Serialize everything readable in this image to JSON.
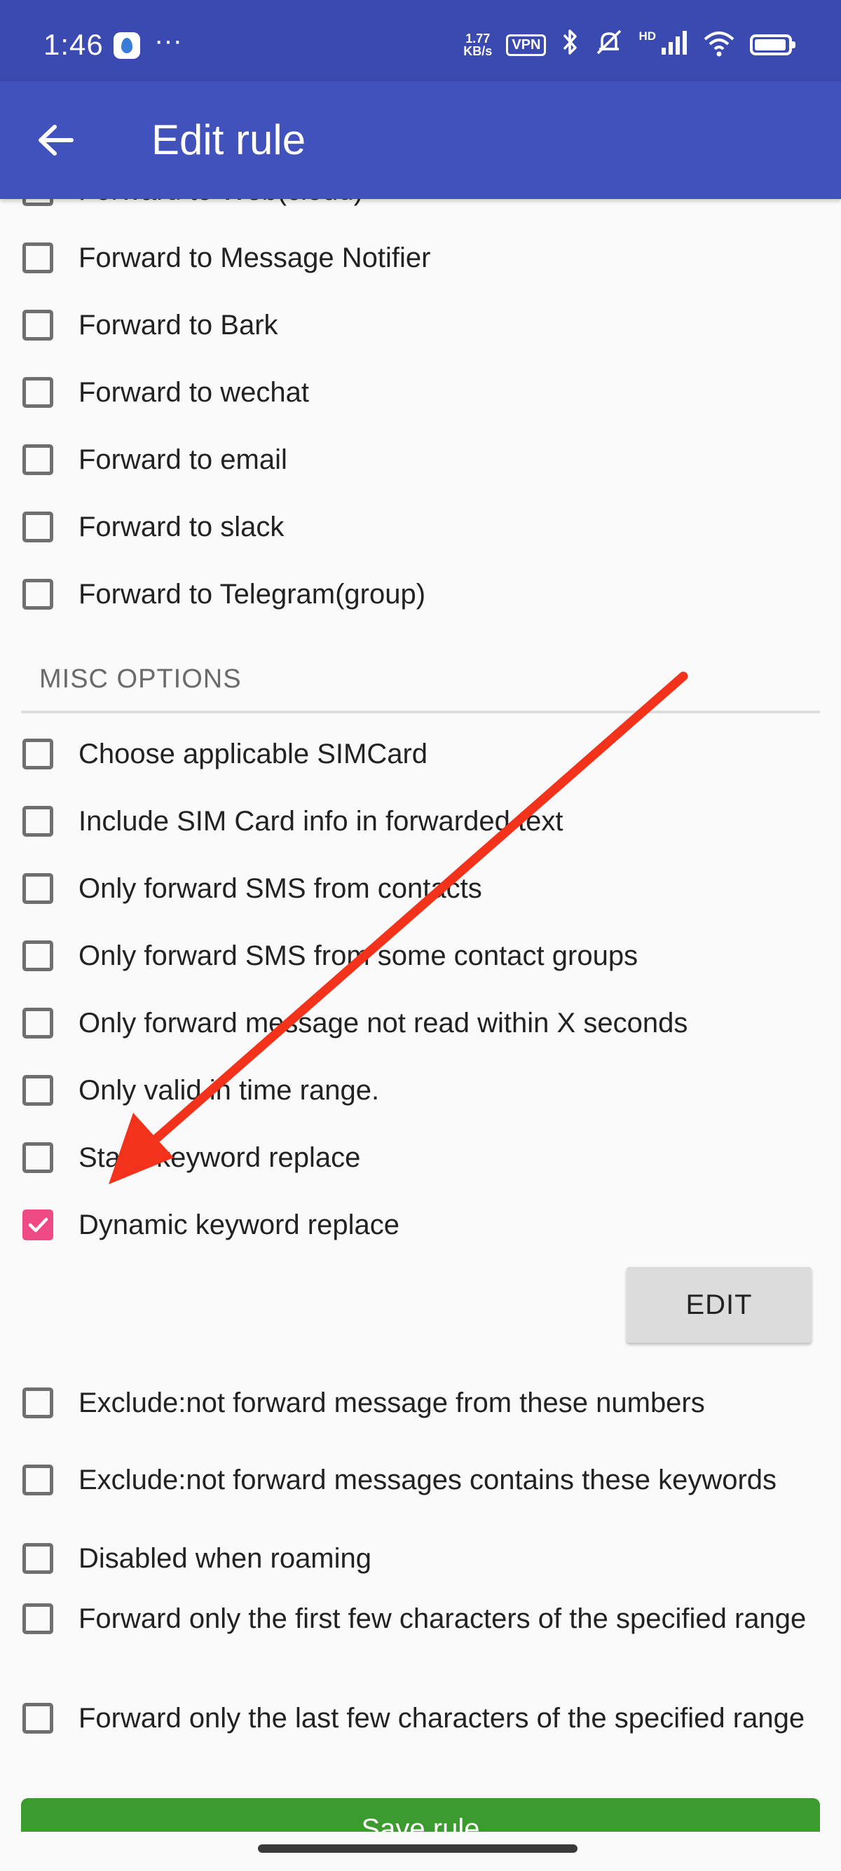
{
  "status_bar": {
    "time": "1:46",
    "more": "···",
    "net_speed_value": "1.77",
    "net_speed_unit": "KB/s",
    "vpn": "VPN",
    "hd": "HD"
  },
  "app_bar": {
    "title": "Edit rule"
  },
  "forward_options": [
    {
      "label": "Forward to Web(cloud)",
      "checked": false
    },
    {
      "label": "Forward to Message Notifier",
      "checked": false
    },
    {
      "label": "Forward to Bark",
      "checked": false
    },
    {
      "label": "Forward to wechat",
      "checked": false
    },
    {
      "label": "Forward to email",
      "checked": false
    },
    {
      "label": "Forward to slack",
      "checked": false
    },
    {
      "label": "Forward to Telegram(group)",
      "checked": false
    }
  ],
  "misc": {
    "title": "MISC OPTIONS",
    "options": [
      {
        "label": "Choose applicable SIMCard",
        "checked": false
      },
      {
        "label": "Include SIM Card info in forwarded text",
        "checked": false
      },
      {
        "label": "Only forward SMS from contacts",
        "checked": false
      },
      {
        "label": "Only forward SMS from some contact groups",
        "checked": false
      },
      {
        "label": "Only forward message not read within X seconds",
        "checked": false
      },
      {
        "label": "Only valid in time range.",
        "checked": false
      },
      {
        "label": "Static keyword replace",
        "checked": false
      },
      {
        "label": "Dynamic keyword replace",
        "checked": true
      }
    ],
    "edit_label": "EDIT",
    "more_options": [
      {
        "label": "Exclude:not forward message from these numbers",
        "checked": false
      },
      {
        "label": "Exclude:not forward messages contains these keywords",
        "checked": false
      },
      {
        "label": "Disabled when roaming",
        "checked": false
      },
      {
        "label": "Forward only the first few characters of the specified range",
        "checked": false
      },
      {
        "label": "Forward only the last few characters of the specified range",
        "checked": false
      }
    ]
  },
  "save_label": "Save rule",
  "colors": {
    "status_bar": "#3a4ab0",
    "app_bar": "#4152bd",
    "checkbox_checked": "#f04a84",
    "arrow": "#f2321a",
    "save_button": "#3c9b2e"
  }
}
